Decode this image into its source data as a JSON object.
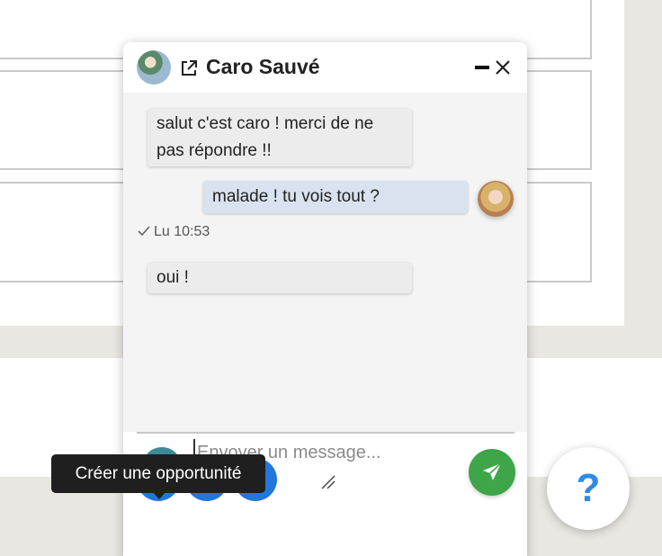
{
  "chat": {
    "contact_name": "Caro Sauvé",
    "messages": [
      {
        "direction": "incoming",
        "text": "salut c'est caro ! merci de ne pas répondre !!"
      },
      {
        "direction": "outgoing",
        "text": "malade ! tu vois tout ?"
      },
      {
        "direction": "incoming",
        "text": "oui !"
      }
    ],
    "read_receipt": "Lu 10:53",
    "composer": {
      "placeholder": "Envoyer un message...",
      "value": ""
    }
  },
  "tooltip": {
    "text": "Créer une opportunité"
  },
  "actions": [
    {
      "icon": "car-icon"
    },
    {
      "icon": "add-email-icon"
    },
    {
      "icon": "add-call-icon"
    }
  ],
  "help": {
    "label": "?"
  },
  "colors": {
    "send": "#3ea549",
    "action": "#2277dd",
    "outgoing_bubble": "#d8e3ef",
    "incoming_bubble": "#ececec",
    "help": "#2f8ce6"
  }
}
